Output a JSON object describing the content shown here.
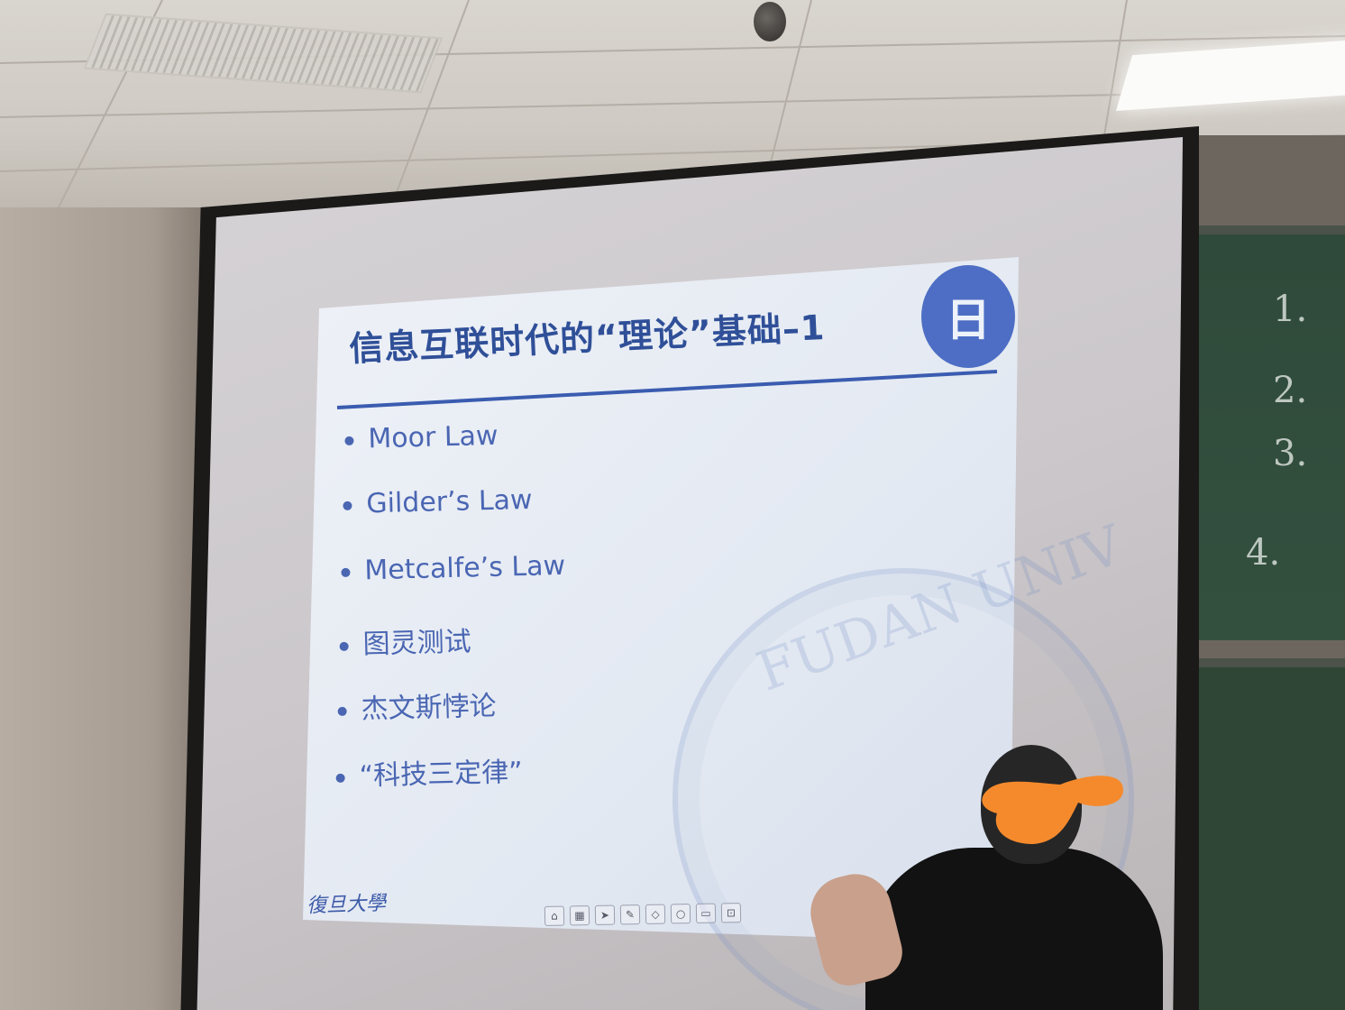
{
  "slide": {
    "title": "信息互联时代的“理论”基础–1",
    "bullets": [
      "Moor Law",
      "Gilder’s Law",
      "Metcalfe’s Law",
      "图灵测试",
      "杰文斯悖论",
      "“科技三定律”"
    ],
    "watermark_text": "FUDAN UNIV",
    "footer_logo": "復旦大學",
    "logo_seal_text": "日",
    "accent_color": "#2f4f98",
    "text_color": "#4a66b3"
  },
  "chalkboard": {
    "marks": [
      "1.",
      "2.",
      "3.",
      "4."
    ]
  },
  "toolbar": {
    "icons": [
      "home-icon",
      "grid-icon",
      "pointer-icon",
      "pen-icon",
      "eraser-icon",
      "search-icon",
      "comment-icon",
      "exit-icon"
    ]
  }
}
